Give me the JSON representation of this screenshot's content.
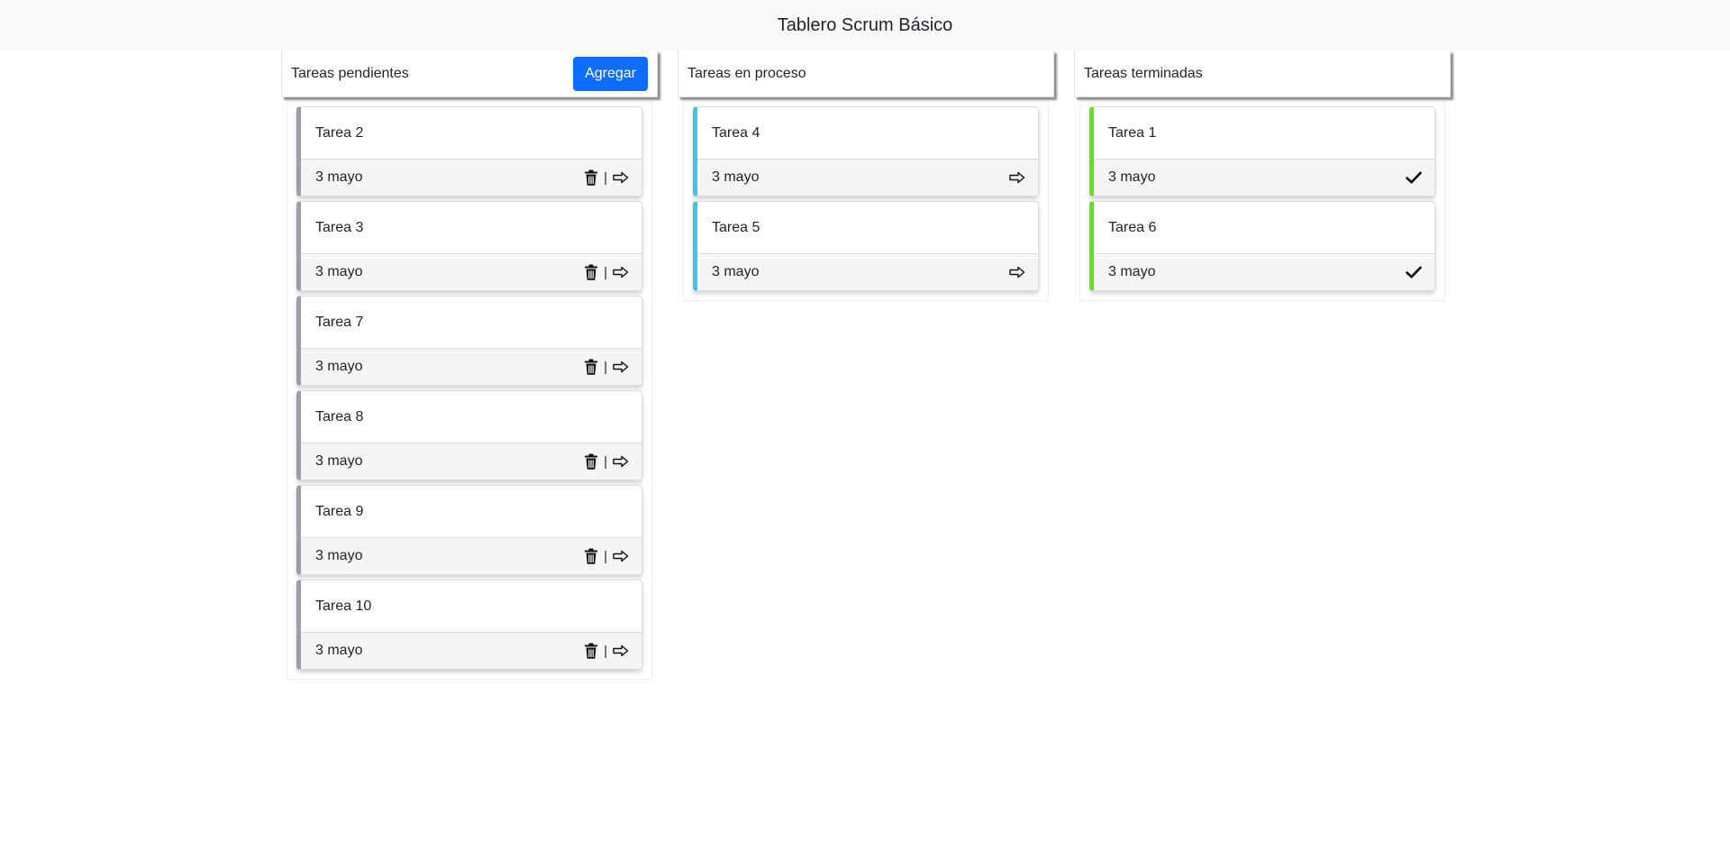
{
  "header": {
    "title": "Tablero Scrum Básico"
  },
  "columns": [
    {
      "title": "Tareas pendientes",
      "add_label": "Agregar",
      "status_color": "#9aa0a6",
      "actions": [
        "trash-icon",
        "separator",
        "arrow-right-icon"
      ],
      "tasks": [
        {
          "name": "Tarea 2",
          "date": "3 mayo"
        },
        {
          "name": "Tarea 3",
          "date": "3 mayo"
        },
        {
          "name": "Tarea 7",
          "date": "3 mayo"
        },
        {
          "name": "Tarea 8",
          "date": "3 mayo"
        },
        {
          "name": "Tarea 9",
          "date": "3 mayo"
        },
        {
          "name": "Tarea 10",
          "date": "3 mayo"
        }
      ]
    },
    {
      "title": "Tareas en proceso",
      "status_color": "#3cc4ee",
      "actions": [
        "arrow-right-icon"
      ],
      "tasks": [
        {
          "name": "Tarea 4",
          "date": "3 mayo"
        },
        {
          "name": "Tarea 5",
          "date": "3 mayo"
        }
      ]
    },
    {
      "title": "Tareas terminadas",
      "status_color": "#5fe21f",
      "actions": [
        "check-icon"
      ],
      "tasks": [
        {
          "name": "Tarea 1",
          "date": "3 mayo"
        },
        {
          "name": "Tarea 6",
          "date": "3 mayo"
        }
      ]
    }
  ],
  "separator_text": "|",
  "colors": {
    "primary": "#0d6efd",
    "topbar": "#f8f9fa"
  }
}
